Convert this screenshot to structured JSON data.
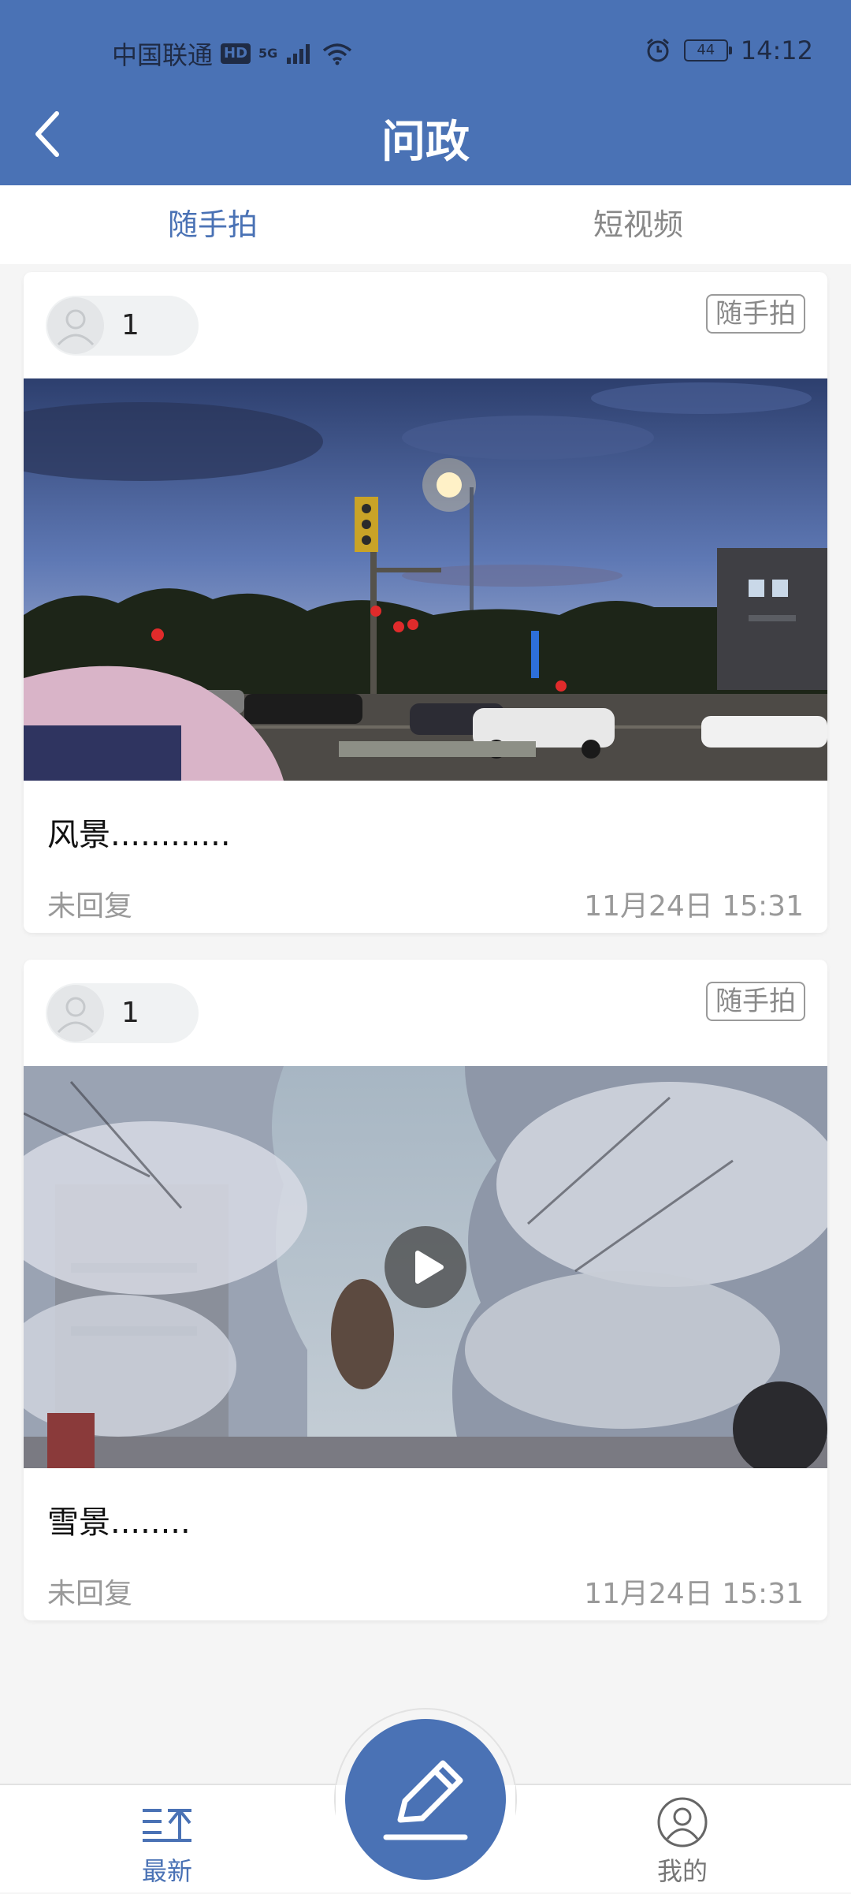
{
  "status_bar": {
    "carrier": "中国联通",
    "hd_badge": "HD",
    "network": "5G",
    "battery": "44",
    "time": "14:12"
  },
  "header": {
    "title": "问政"
  },
  "tabs": [
    {
      "label": "随手拍",
      "active": true
    },
    {
      "label": "短视频",
      "active": false
    }
  ],
  "posts": [
    {
      "user_count": "1",
      "tag": "随手拍",
      "media_type": "image",
      "title": "风景............",
      "status": "未回复",
      "time": "11月24日 15:31"
    },
    {
      "user_count": "1",
      "tag": "随手拍",
      "media_type": "video",
      "title": "雪景........",
      "status": "未回复",
      "time": "11月24日 15:31"
    }
  ],
  "bottom_nav": {
    "latest_label": "最新",
    "mine_label": "我的"
  },
  "colors": {
    "primary": "#4a72b5",
    "muted_text": "#999999",
    "background": "#f5f5f5"
  },
  "icons": [
    "back-chevron-icon",
    "alarm-icon",
    "wifi-icon",
    "signal-icon",
    "user-avatar-icon",
    "play-icon",
    "latest-list-icon",
    "edit-pencil-icon",
    "profile-icon"
  ]
}
